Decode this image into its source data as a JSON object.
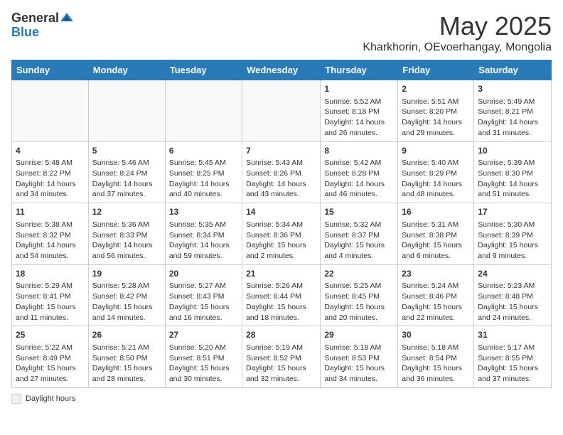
{
  "header": {
    "logo_general": "General",
    "logo_blue": "Blue",
    "title": "May 2025",
    "subtitle": "Kharkhorin, OEvoerhangay, Mongolia"
  },
  "days_of_week": [
    "Sunday",
    "Monday",
    "Tuesday",
    "Wednesday",
    "Thursday",
    "Friday",
    "Saturday"
  ],
  "weeks": [
    [
      {
        "day": "",
        "info": ""
      },
      {
        "day": "",
        "info": ""
      },
      {
        "day": "",
        "info": ""
      },
      {
        "day": "",
        "info": ""
      },
      {
        "day": "1",
        "info": "Sunrise: 5:52 AM\nSunset: 8:18 PM\nDaylight: 14 hours and 26 minutes."
      },
      {
        "day": "2",
        "info": "Sunrise: 5:51 AM\nSunset: 8:20 PM\nDaylight: 14 hours and 29 minutes."
      },
      {
        "day": "3",
        "info": "Sunrise: 5:49 AM\nSunset: 8:21 PM\nDaylight: 14 hours and 31 minutes."
      }
    ],
    [
      {
        "day": "4",
        "info": "Sunrise: 5:48 AM\nSunset: 8:22 PM\nDaylight: 14 hours and 34 minutes."
      },
      {
        "day": "5",
        "info": "Sunrise: 5:46 AM\nSunset: 8:24 PM\nDaylight: 14 hours and 37 minutes."
      },
      {
        "day": "6",
        "info": "Sunrise: 5:45 AM\nSunset: 8:25 PM\nDaylight: 14 hours and 40 minutes."
      },
      {
        "day": "7",
        "info": "Sunrise: 5:43 AM\nSunset: 8:26 PM\nDaylight: 14 hours and 43 minutes."
      },
      {
        "day": "8",
        "info": "Sunrise: 5:42 AM\nSunset: 8:28 PM\nDaylight: 14 hours and 46 minutes."
      },
      {
        "day": "9",
        "info": "Sunrise: 5:40 AM\nSunset: 8:29 PM\nDaylight: 14 hours and 48 minutes."
      },
      {
        "day": "10",
        "info": "Sunrise: 5:39 AM\nSunset: 8:30 PM\nDaylight: 14 hours and 51 minutes."
      }
    ],
    [
      {
        "day": "11",
        "info": "Sunrise: 5:38 AM\nSunset: 8:32 PM\nDaylight: 14 hours and 54 minutes."
      },
      {
        "day": "12",
        "info": "Sunrise: 5:36 AM\nSunset: 8:33 PM\nDaylight: 14 hours and 56 minutes."
      },
      {
        "day": "13",
        "info": "Sunrise: 5:35 AM\nSunset: 8:34 PM\nDaylight: 14 hours and 59 minutes."
      },
      {
        "day": "14",
        "info": "Sunrise: 5:34 AM\nSunset: 8:36 PM\nDaylight: 15 hours and 2 minutes."
      },
      {
        "day": "15",
        "info": "Sunrise: 5:32 AM\nSunset: 8:37 PM\nDaylight: 15 hours and 4 minutes."
      },
      {
        "day": "16",
        "info": "Sunrise: 5:31 AM\nSunset: 8:38 PM\nDaylight: 15 hours and 6 minutes."
      },
      {
        "day": "17",
        "info": "Sunrise: 5:30 AM\nSunset: 8:39 PM\nDaylight: 15 hours and 9 minutes."
      }
    ],
    [
      {
        "day": "18",
        "info": "Sunrise: 5:29 AM\nSunset: 8:41 PM\nDaylight: 15 hours and 11 minutes."
      },
      {
        "day": "19",
        "info": "Sunrise: 5:28 AM\nSunset: 8:42 PM\nDaylight: 15 hours and 14 minutes."
      },
      {
        "day": "20",
        "info": "Sunrise: 5:27 AM\nSunset: 8:43 PM\nDaylight: 15 hours and 16 minutes."
      },
      {
        "day": "21",
        "info": "Sunrise: 5:26 AM\nSunset: 8:44 PM\nDaylight: 15 hours and 18 minutes."
      },
      {
        "day": "22",
        "info": "Sunrise: 5:25 AM\nSunset: 8:45 PM\nDaylight: 15 hours and 20 minutes."
      },
      {
        "day": "23",
        "info": "Sunrise: 5:24 AM\nSunset: 8:46 PM\nDaylight: 15 hours and 22 minutes."
      },
      {
        "day": "24",
        "info": "Sunrise: 5:23 AM\nSunset: 8:48 PM\nDaylight: 15 hours and 24 minutes."
      }
    ],
    [
      {
        "day": "25",
        "info": "Sunrise: 5:22 AM\nSunset: 8:49 PM\nDaylight: 15 hours and 27 minutes."
      },
      {
        "day": "26",
        "info": "Sunrise: 5:21 AM\nSunset: 8:50 PM\nDaylight: 15 hours and 28 minutes."
      },
      {
        "day": "27",
        "info": "Sunrise: 5:20 AM\nSunset: 8:51 PM\nDaylight: 15 hours and 30 minutes."
      },
      {
        "day": "28",
        "info": "Sunrise: 5:19 AM\nSunset: 8:52 PM\nDaylight: 15 hours and 32 minutes."
      },
      {
        "day": "29",
        "info": "Sunrise: 5:18 AM\nSunset: 8:53 PM\nDaylight: 15 hours and 34 minutes."
      },
      {
        "day": "30",
        "info": "Sunrise: 5:18 AM\nSunset: 8:54 PM\nDaylight: 15 hours and 36 minutes."
      },
      {
        "day": "31",
        "info": "Sunrise: 5:17 AM\nSunset: 8:55 PM\nDaylight: 15 hours and 37 minutes."
      }
    ]
  ],
  "footer": {
    "note_label": "Daylight hours"
  }
}
